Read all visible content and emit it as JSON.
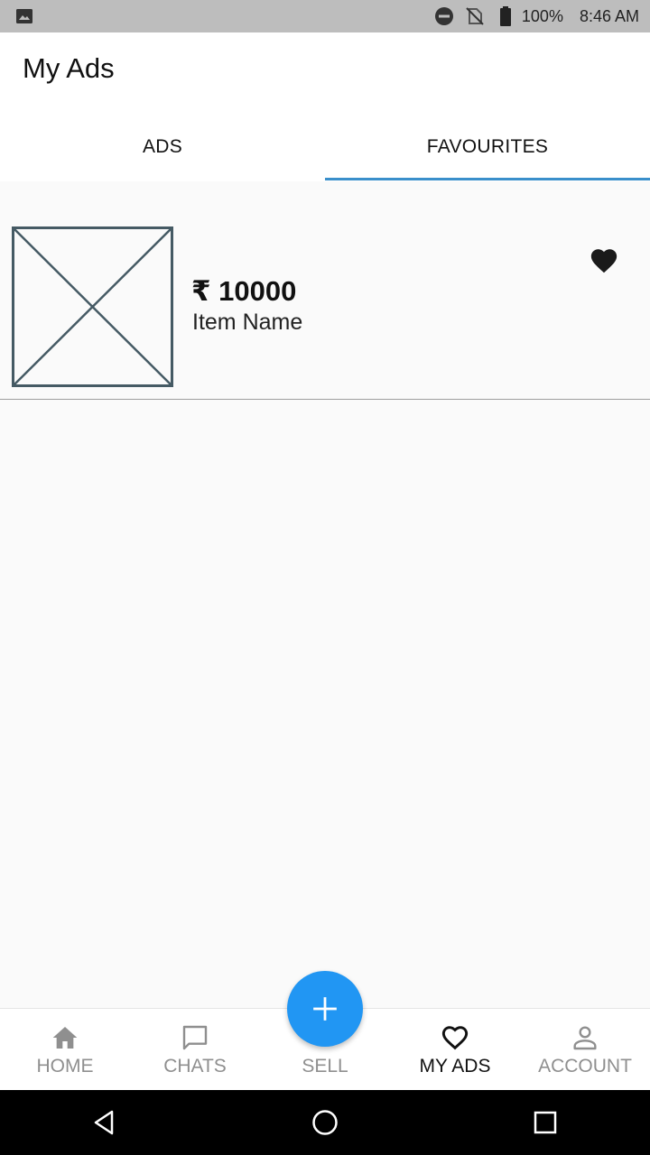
{
  "status_bar": {
    "battery": "100%",
    "time": "8:46 AM",
    "icons": [
      "gallery-icon",
      "do-not-disturb-icon",
      "no-sim-icon",
      "battery-icon"
    ]
  },
  "header": {
    "title": "My Ads",
    "tabs": [
      {
        "label": "ADS",
        "active": false
      },
      {
        "label": "FAVOURITES",
        "active": true
      }
    ],
    "accent": "#3a8fcb"
  },
  "favourites": [
    {
      "price": "₹ 10000",
      "name": "Item Name",
      "image": "placeholder-image-icon",
      "favourited": true
    }
  ],
  "bottom_nav": {
    "items": [
      {
        "label": "HOME",
        "icon": "home-icon",
        "active": false
      },
      {
        "label": "CHATS",
        "icon": "chat-icon",
        "active": false
      },
      {
        "label": "SELL",
        "icon": "plus-icon",
        "active": false
      },
      {
        "label": "MY ADS",
        "icon": "heart-outline-icon",
        "active": true
      },
      {
        "label": "ACCOUNT",
        "icon": "account-icon",
        "active": false
      }
    ],
    "fab_color": "#2196f3"
  },
  "system_nav": {
    "icons": [
      "back-icon",
      "home-circle-icon",
      "recents-icon"
    ]
  }
}
